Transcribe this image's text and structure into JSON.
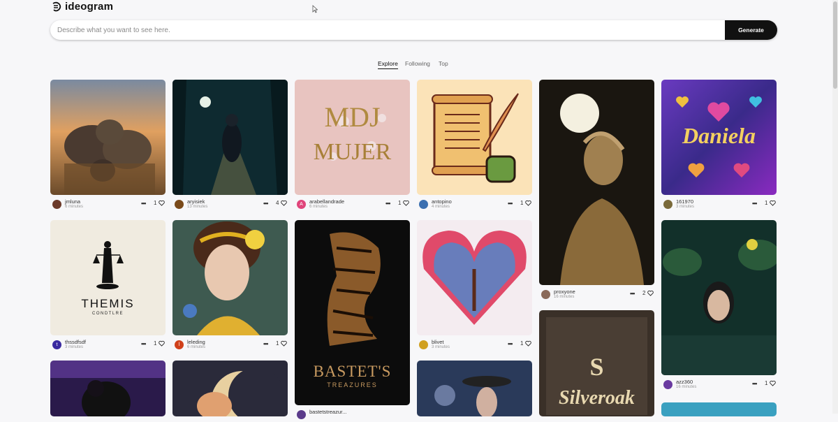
{
  "app": {
    "logo_text": "ideogram"
  },
  "search": {
    "placeholder": "Describe what you want to see here.",
    "button_label": "Generate"
  },
  "tabs": [
    {
      "label": "Explore",
      "active": true
    },
    {
      "label": "Following",
      "active": false
    },
    {
      "label": "Top",
      "active": false
    }
  ],
  "cards": [
    {
      "user": "jmluna",
      "time": "6 minutes",
      "likes": "1",
      "avatar_color": "#6b3a2a",
      "avatar_letter": ""
    },
    {
      "user": "aryisiek",
      "time": "13 minutes",
      "likes": "4",
      "avatar_color": "#7a4a1a",
      "avatar_letter": ""
    },
    {
      "user": "arabellandrade",
      "time": "6 minutes",
      "likes": "1",
      "avatar_color": "#e0457b",
      "avatar_letter": "A"
    },
    {
      "user": "antopino",
      "time": "4 minutes",
      "likes": "1",
      "avatar_color": "#3b6fb0",
      "avatar_letter": ""
    },
    {
      "user": "proxyone",
      "time": "16 minutes",
      "likes": "2",
      "avatar_color": "#8a6a5a",
      "avatar_letter": ""
    },
    {
      "user": "161970",
      "time": "3 minutes",
      "likes": "1",
      "avatar_color": "#7a6a3a",
      "avatar_letter": ""
    },
    {
      "user": "thssdfsdf",
      "time": "3 minutes",
      "likes": "1",
      "avatar_color": "#3a2aa0",
      "avatar_letter": "t"
    },
    {
      "user": "leleding",
      "time": "6 minutes",
      "likes": "1",
      "avatar_color": "#d0401a",
      "avatar_letter": "l"
    },
    {
      "user": "bastetstreazur...",
      "time": "",
      "likes": "",
      "avatar_color": "#5a3a8a",
      "avatar_letter": ""
    },
    {
      "user": "blivet",
      "time": "3 minutes",
      "likes": "1",
      "avatar_color": "#d0a020",
      "avatar_letter": ""
    },
    {
      "user": "azz360",
      "time": "16 minutes",
      "likes": "1",
      "avatar_color": "#6a3aa0",
      "avatar_letter": ""
    }
  ],
  "image_text": {
    "themis_title": "THEMIS",
    "themis_sub": "CONDTLRE",
    "bastet_title": "BASTET'S",
    "bastet_sub": "TREAZURES",
    "daniela": "Daniela",
    "silveroak": "Silveroak",
    "silveroak_letter": "S",
    "mdmujer_top": "MDJ",
    "mdmujer_bottom": "MUJER"
  },
  "colors": {
    "generate_bg": "#111111",
    "page_bg": "#f7f7f9"
  }
}
